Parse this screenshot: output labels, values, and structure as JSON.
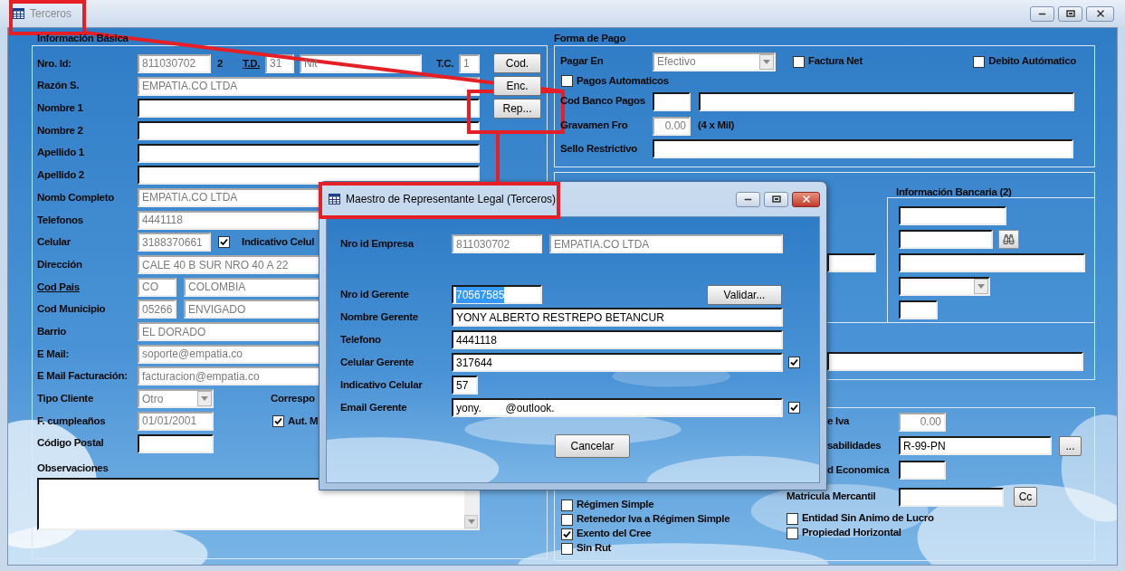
{
  "window": {
    "title": "Terceros"
  },
  "basic": {
    "title": "Información Básica",
    "rows": [
      {
        "label": "Nro. Id:",
        "link": false,
        "cells": [
          {
            "kind": "field",
            "value": "811030702",
            "disabled": true
          },
          {
            "kind": "text",
            "text": "2"
          },
          {
            "kind": "link",
            "text": "T.D."
          },
          {
            "kind": "field",
            "value": "31",
            "disabled": true
          },
          {
            "kind": "field",
            "value": "Nit",
            "disabled": true
          },
          {
            "kind": "text",
            "text": "T.C."
          },
          {
            "kind": "field",
            "value": "1",
            "disabled": true
          },
          {
            "kind": "button",
            "text": "Cod."
          }
        ]
      },
      {
        "label": "Razón S.",
        "link": false,
        "cells": [
          {
            "kind": "field",
            "value": "EMPATIA.CO LTDA",
            "disabled": true
          },
          {
            "kind": "button",
            "text": "Enc."
          }
        ]
      },
      {
        "label": "Nombre 1",
        "link": false,
        "cells": [
          {
            "kind": "field",
            "disabled": false
          },
          {
            "kind": "button",
            "text": "Rep..."
          }
        ]
      },
      {
        "label": "Nombre 2",
        "link": false,
        "cells": [
          {
            "kind": "field",
            "disabled": false
          }
        ]
      },
      {
        "label": "Apellido 1",
        "link": false,
        "cells": [
          {
            "kind": "field",
            "disabled": false
          }
        ]
      },
      {
        "label": "Apellido 2",
        "link": false,
        "cells": [
          {
            "kind": "field",
            "disabled": false
          }
        ]
      },
      {
        "label": "Nomb Completo",
        "link": false,
        "cells": [
          {
            "kind": "field",
            "value": "EMPATIA.CO LTDA",
            "disabled": true
          }
        ]
      },
      {
        "label": "Telefonos",
        "link": false,
        "cells": [
          {
            "kind": "field",
            "value": "4441118",
            "disabled": true
          }
        ]
      },
      {
        "label": "Celular",
        "link": false,
        "cells": [
          {
            "kind": "field",
            "value": "3188370661",
            "disabled": true
          },
          {
            "kind": "checkbox",
            "label": "Indicativo Celul",
            "checked": true
          }
        ]
      },
      {
        "label": "Dirección",
        "link": false,
        "cells": [
          {
            "kind": "field",
            "value": "CALE 40 B SUR NRO 40 A 22",
            "disabled": true
          }
        ]
      },
      {
        "label": "Cod Pais",
        "link": true,
        "cells": [
          {
            "kind": "field",
            "value": "CO",
            "disabled": true
          },
          {
            "kind": "field",
            "value": "COLOMBIA",
            "disabled": true
          }
        ]
      },
      {
        "label": "Cod Municipio",
        "link": false,
        "cells": [
          {
            "kind": "field",
            "value": "05266",
            "disabled": true
          },
          {
            "kind": "field",
            "value": "ENVIGADO",
            "disabled": true
          }
        ]
      },
      {
        "label": "Barrio",
        "link": false,
        "cells": [
          {
            "kind": "field",
            "value": "EL DORADO",
            "disabled": true
          }
        ]
      },
      {
        "label": "E Mail:",
        "link": false,
        "cells": [
          {
            "kind": "field",
            "value": "soporte@empatia.co",
            "disabled": true
          }
        ]
      },
      {
        "label": "E Mail Facturación:",
        "link": false,
        "cells": [
          {
            "kind": "field",
            "value": "facturacion@empatia.co",
            "disabled": true
          }
        ]
      },
      {
        "label": "Tipo Cliente",
        "link": false,
        "cells": [
          {
            "kind": "dropdown",
            "value": "Otro",
            "disabled": true
          },
          {
            "kind": "text",
            "text": "Correspo"
          }
        ]
      },
      {
        "label": "F. cumpleaños",
        "link": false,
        "cells": [
          {
            "kind": "field",
            "value": "01/01/2001",
            "disabled": true
          },
          {
            "kind": "checkbox",
            "label": "Aut. M",
            "checked": true
          }
        ]
      },
      {
        "label": "Código Postal",
        "link": false,
        "cells": [
          {
            "kind": "field",
            "disabled": false
          }
        ]
      }
    ],
    "notes_label": "Observaciones"
  },
  "payment": {
    "title": "Forma de Pago",
    "rows": [
      {
        "label": "Pagar En",
        "cells": [
          {
            "kind": "dropdown",
            "value": "Efectivo",
            "disabled": true
          },
          {
            "kind": "checkbox",
            "label": "Factura Net",
            "checked": false
          },
          {
            "kind": "checkbox",
            "label": "Debito Autómatico",
            "checked": false
          }
        ]
      },
      {
        "cells": [
          {
            "kind": "checkbox",
            "label": "Pagos Automaticos",
            "checked": false
          }
        ]
      },
      {
        "label": "Cod Banco Pagos",
        "cells": [
          {
            "kind": "field",
            "disabled": false
          },
          {
            "kind": "field",
            "disabled": false
          }
        ]
      },
      {
        "label": "Gravamen Fro",
        "cells": [
          {
            "kind": "field",
            "value": "0.00",
            "disabled": true
          },
          {
            "kind": "text",
            "text": "(4 x Mil)"
          }
        ]
      },
      {
        "label": "Sello Restrictivo",
        "cells": [
          {
            "kind": "field",
            "disabled": false
          }
        ]
      }
    ]
  },
  "other_fields": [
    {
      "kind": "field",
      "disabled": false
    },
    {
      "kind": "field",
      "disabled": false
    }
  ],
  "bank": {
    "title": "Información Bancaria (2)",
    "rows": [
      {
        "cells": [
          {
            "kind": "field",
            "disabled": false
          }
        ]
      },
      {
        "cells": [
          {
            "kind": "field",
            "disabled": false
          },
          {
            "kind": "search_button"
          }
        ]
      },
      {
        "cells": [
          {
            "kind": "field",
            "disabled": false
          }
        ]
      },
      {
        "cells": [
          {
            "kind": "dropdown",
            "disabled": false
          }
        ]
      },
      {
        "cells": [
          {
            "kind": "field",
            "disabled": false
          }
        ]
      }
    ]
  },
  "tax": {
    "checks": [
      {
        "label": "Régimen Simple",
        "checked": false
      },
      {
        "label": "Retenedor Iva a Régimen Simple",
        "checked": false
      },
      {
        "label": "Exento del Cree",
        "checked": true
      },
      {
        "label": "Sin Rut",
        "checked": false
      }
    ],
    "rows": [
      {
        "label": "e Iva",
        "cells": [
          {
            "kind": "field",
            "value": "0.00",
            "disabled": true
          }
        ]
      },
      {
        "label": "sabilidades",
        "cells": [
          {
            "kind": "field",
            "value": "R-99-PN",
            "disabled": false
          },
          {
            "kind": "button",
            "text": "..."
          }
        ]
      },
      {
        "label": "d Economica",
        "cells": [
          {
            "kind": "field",
            "disabled": false
          }
        ]
      },
      {
        "label": "Matricula Mercantil",
        "cells": [
          {
            "kind": "field",
            "disabled": false
          },
          {
            "kind": "button",
            "text": "Cc"
          }
        ]
      }
    ],
    "options": [
      {
        "label": "Entidad Sin Animo de Lucro",
        "checked": false
      },
      {
        "label": "Propiedad Horizontal",
        "checked": false
      }
    ]
  },
  "dialog": {
    "title": "Maestro de Representante Legal (Terceros)",
    "rows": [
      {
        "label": "Nro id Empresa",
        "cells": [
          {
            "kind": "field",
            "value": "811030702",
            "disabled": true
          },
          {
            "kind": "field",
            "value": "EMPATIA.CO LTDA",
            "disabled": true
          }
        ]
      },
      {
        "label": "Nro id Gerente",
        "cells": [
          {
            "kind": "field",
            "value": "70567585",
            "disabled": false,
            "selected": true
          },
          {
            "kind": "button",
            "text": "Validar..."
          }
        ]
      },
      {
        "label": "Nombre Gerente",
        "cells": [
          {
            "kind": "field",
            "value": "YONY ALBERTO RESTREPO BETANCUR",
            "disabled": false
          }
        ]
      },
      {
        "label": "Telefono",
        "cells": [
          {
            "kind": "field",
            "value": "4441118",
            "disabled": false
          }
        ]
      },
      {
        "label": "Celular Gerente",
        "cells": [
          {
            "kind": "field",
            "value": "317644",
            "disabled": false
          },
          {
            "kind": "checkbox",
            "checked": true
          }
        ]
      },
      {
        "label": "Indicativo Celular",
        "cells": [
          {
            "kind": "field",
            "value": "57",
            "disabled": false
          }
        ]
      },
      {
        "label": "Email Gerente",
        "cells": [
          {
            "kind": "field",
            "value": "yony.        @outlook.",
            "disabled": false
          },
          {
            "kind": "checkbox",
            "checked": true
          }
        ]
      }
    ],
    "buttons": [
      "Cancelar"
    ]
  }
}
